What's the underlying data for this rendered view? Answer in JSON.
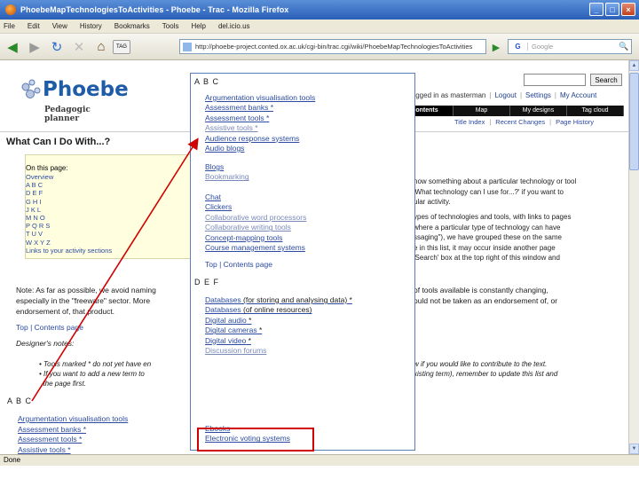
{
  "window": {
    "title": "PhoebeMapTechnologiesToActivities - Phoebe - Trac - Mozilla Firefox",
    "minimize": "_",
    "maximize": "□",
    "close": "×"
  },
  "menu": [
    "File",
    "Edit",
    "View",
    "History",
    "Bookmarks",
    "Tools",
    "Help",
    "del.icio.us"
  ],
  "toolbar": {
    "back": "◀",
    "forward": "▶",
    "reload": "↻",
    "stop": "✕",
    "home": "⌂",
    "tag": "TAG",
    "url": "http://phoebe-project.conted.ox.ac.uk/cgi-bin/trac.cgi/wiki/PhoebeMapTechnologiesToActivities",
    "go": "▶",
    "search_engine": "G",
    "search_placeholder": "Google",
    "search_icon": "🔍"
  },
  "header": {
    "logo_name": "Phoebe",
    "logo_subtitle": "Pedagogic planner",
    "search_button": "Search",
    "metanav": {
      "logged_in": "logged in as masterman",
      "logout": "Logout",
      "settings": "Settings",
      "my_account": "My Account"
    },
    "mainnav": [
      "Contents",
      "Map",
      "My designs",
      "Tag cloud"
    ],
    "ctxnav": [
      "Title Index",
      "Recent Changes",
      "Page History"
    ]
  },
  "page": {
    "heading": "What Can I Do With...?",
    "toc_title": "On this page:",
    "toc_items": [
      "Overview",
      "A B C",
      "D E F",
      "G H I",
      "J K L",
      "M N O",
      "P Q R S",
      "T U V",
      "W X Y Z",
      "Links to your activity sections"
    ],
    "intro_right": [
      "now something about a particular technology or tool",
      "'What technology can I use for...?' if you want to",
      "ular activity."
    ],
    "intro_right2": [
      "ypes of technologies and tools, with links to pages",
      "where a particular type of technology can have",
      "ssaging\"), we have grouped these on the same",
      "e in this list, it may occur inside another page",
      "'Search' box at the top right of this window and"
    ],
    "note_left": [
      "Note: As far as possible, we avoid naming",
      "especially in the \"freeware\" sector. More",
      "endorsement of, that product."
    ],
    "note_right": [
      "of tools available is constantly changing,",
      "ould not be taken as an endorsement of, or"
    ],
    "top_link": "Top",
    "contents_link": "Contents page",
    "designers_heading": "Designer's notes:",
    "bullets_left": [
      "Tools marked * do not yet have en",
      "If you want to add a new term to",
      "the page first."
    ],
    "bullets_right": [
      "w if you would like to contribute to the text.",
      "xisting term), remember to update this list and"
    ],
    "abc_heading": "A B C",
    "abc_items": [
      "Argumentation visualisation tools",
      "Assessment banks *",
      "Assessment tools *",
      "Assistive tools *"
    ]
  },
  "popup": {
    "abc_heading": "A B C",
    "abc_group1": [
      "Argumentation visualisation tools",
      "Assessment banks *",
      "Assessment tools *",
      "Assistive tools *",
      "Audience response systems",
      "Audio blogs"
    ],
    "abc_group2": [
      "Blogs",
      "Bookmarking"
    ],
    "abc_group3": [
      "Chat",
      "Clickers",
      "Collaborative word processors",
      "Collaborative writing tools",
      "Concept-mapping tools",
      "Course management systems"
    ],
    "top_link": "Top",
    "contents_link": "Contents page",
    "def_heading": "D E F",
    "def_items": [
      {
        "text": "Databases",
        "suffix": " (for storing and analysing data) *"
      },
      {
        "text": "Databases",
        "suffix": " (of online resources)"
      },
      {
        "text": "Digital audio",
        "suffix": " *"
      },
      {
        "text": "Digital cameras",
        "suffix": " *"
      },
      {
        "text": "Digital video",
        "suffix": " *"
      },
      {
        "text": "Discussion forums",
        "suffix": ""
      }
    ],
    "def_items2": [
      "Ebooks",
      "Electronic voting systems"
    ]
  },
  "status": "Done",
  "colors": {
    "annotation": "#d00000",
    "link": "#2b4aa0",
    "brand": "#1f5ca8"
  }
}
